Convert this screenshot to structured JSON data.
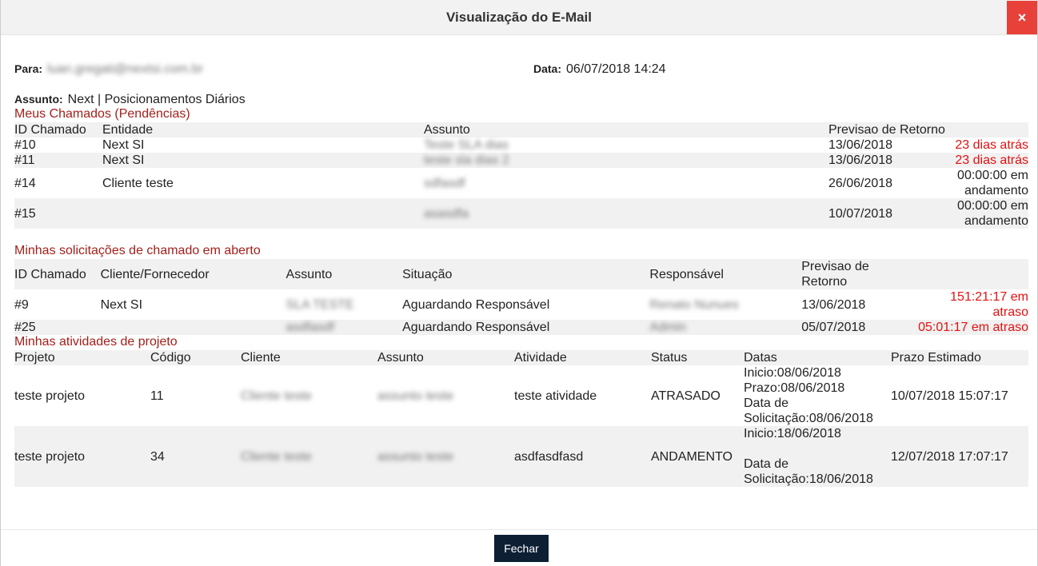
{
  "modal": {
    "title": "Visualização do E-Mail",
    "close_icon": "×",
    "close_label": "Fechar"
  },
  "meta": {
    "para_label": "Para:",
    "para_value": "luan.gregati@nextsi.com.br",
    "data_label": "Data:",
    "data_value": "06/07/2018 14:24",
    "assunto_label": "Assunto:",
    "assunto_value": "Next | Posicionamentos Diários"
  },
  "chamados": {
    "title": "Meus Chamados (Pendências)",
    "headers": [
      "ID Chamado",
      "Entidade",
      "Assunto",
      "Previsao de Retorno",
      ""
    ],
    "rows": [
      {
        "id": "#10",
        "entidade": "Next SI",
        "assunto": "Teste SLA dias",
        "previsao": "13/06/2018",
        "status": "23 dias atrás",
        "late": true
      },
      {
        "id": "#11",
        "entidade": "Next SI",
        "assunto": "teste sla dias 2",
        "previsao": "13/06/2018",
        "status": "23 dias atrás",
        "late": true
      },
      {
        "id": "#14",
        "entidade": "Cliente teste",
        "assunto": "sdfasdf",
        "previsao": "26/06/2018",
        "status": "00:00:00 em andamento",
        "late": false
      },
      {
        "id": "#15",
        "entidade": "",
        "assunto": "asasdfa",
        "previsao": "10/07/2018",
        "status": "00:00:00 em andamento",
        "late": false
      }
    ]
  },
  "solicitacoes": {
    "title": "Minhas solicitações de chamado em aberto",
    "headers": [
      "ID Chamado",
      "Cliente/Fornecedor",
      "Assunto",
      "Situação",
      "Responsável",
      "Previsao de Retorno",
      ""
    ],
    "rows": [
      {
        "id": "#9",
        "cliente": "Next SI",
        "assunto": "SLA TESTE",
        "situacao": "Aguardando Responsável",
        "responsavel": "Renato Nunues",
        "previsao": "13/06/2018",
        "status": "151:21:17 em atraso"
      },
      {
        "id": "#25",
        "cliente": "",
        "assunto": "asdfasdf",
        "situacao": "Aguardando Responsável",
        "responsavel": "Admin",
        "previsao": "05/07/2018",
        "status": "05:01:17 em atraso"
      }
    ]
  },
  "atividades": {
    "title": "Minhas atividades de projeto",
    "headers": [
      "Projeto",
      "Código",
      "Cliente",
      "Assunto",
      "Atividade",
      "Status",
      "Datas",
      "Prazo Estimado"
    ],
    "rows": [
      {
        "projeto": "teste projeto",
        "codigo": "11",
        "cliente": "Cliente teste",
        "assunto": "assunto teste",
        "atividade": "teste atividade",
        "status": "ATRASADO",
        "datas": [
          "Inicio:08/06/2018",
          "Prazo:08/06/2018",
          "Data de",
          "Solicitação:08/06/2018"
        ],
        "prazo": "10/07/2018 15:07:17"
      },
      {
        "projeto": "teste projeto",
        "codigo": "34",
        "cliente": "Cliente teste",
        "assunto": "assunto teste",
        "atividade": "asdfasdfasd",
        "status": "ANDAMENTO",
        "datas": [
          "Inicio:18/06/2018",
          "",
          "Data de",
          "Solicitação:18/06/2018"
        ],
        "prazo": "12/07/2018 17:07:17"
      }
    ]
  }
}
